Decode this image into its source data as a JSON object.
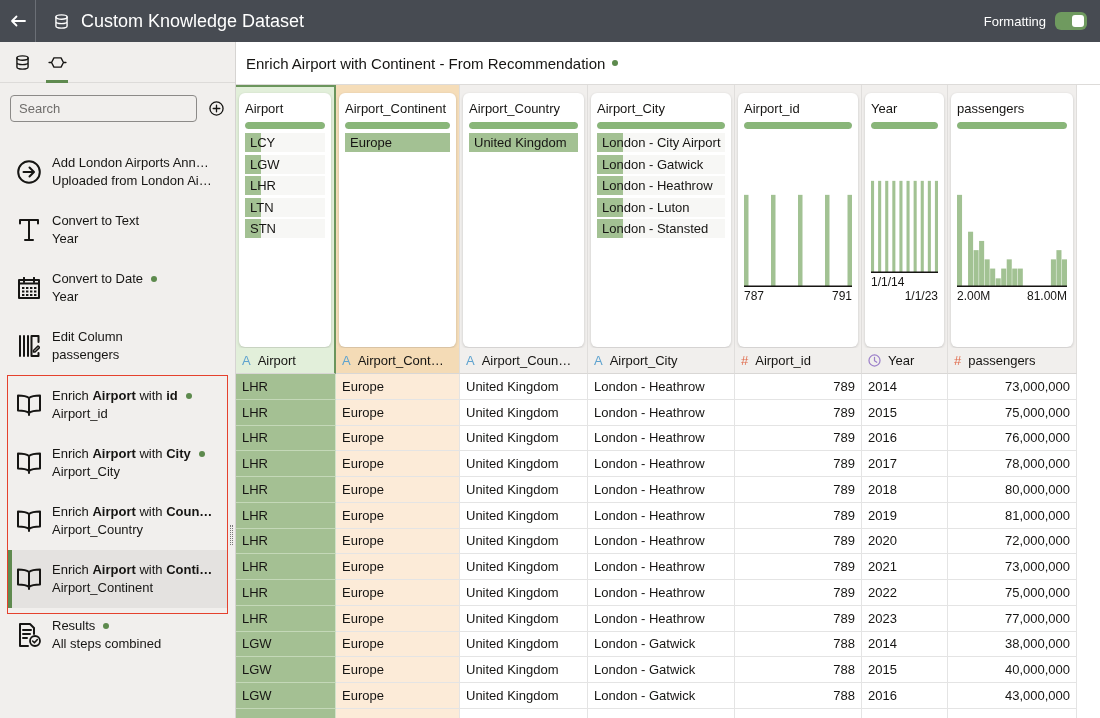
{
  "top_bar": {
    "title": "Custom Knowledge Dataset",
    "formatting": {
      "label": "Formatting",
      "on": true
    }
  },
  "sidebar": {
    "tabs": [
      {
        "kind": "dataset",
        "selected": false
      },
      {
        "kind": "steps",
        "selected": true
      }
    ],
    "search": {
      "placeholder": "Search"
    },
    "steps": [
      {
        "kind": "source",
        "title": "Add London Airports Ann…",
        "subtitle": "Uploaded from London Ai…",
        "dot": false,
        "selected": false,
        "highlighted": false
      },
      {
        "kind": "text",
        "title": "Convert to Text",
        "subtitle": "Year",
        "dot": false,
        "selected": false,
        "highlighted": false
      },
      {
        "kind": "date",
        "title": "Convert to Date",
        "subtitle": "Year",
        "dot": true,
        "selected": false,
        "highlighted": false
      },
      {
        "kind": "edit",
        "title": "Edit Column",
        "subtitle": "passengers",
        "dot": false,
        "selected": false,
        "highlighted": false
      },
      {
        "kind": "enrich",
        "title": "Enrich **Airport** with **id**",
        "subtitle": "Airport_id",
        "dot": true,
        "selected": false,
        "highlighted": true
      },
      {
        "kind": "enrich",
        "title": "Enrich **Airport** with **City**",
        "subtitle": "Airport_City",
        "dot": true,
        "selected": false,
        "highlighted": true
      },
      {
        "kind": "enrich",
        "title": "Enrich **Airport** with **Coun…**",
        "subtitle": "Airport_Country",
        "dot": false,
        "selected": false,
        "highlighted": true
      },
      {
        "kind": "enrich",
        "title": "Enrich **Airport** with **Conti…**",
        "subtitle": "Airport_Continent",
        "dot": false,
        "selected": true,
        "highlighted": true
      },
      {
        "kind": "results",
        "title": "Results",
        "subtitle": "All steps combined",
        "dot": true,
        "selected": false,
        "highlighted": false
      }
    ]
  },
  "header": {
    "title": "Enrich Airport with Continent - From Recommendation",
    "dot": true
  },
  "columns": [
    {
      "name": "Airport",
      "label": "Airport",
      "kind": "text",
      "type_symbol": "A",
      "selected": true,
      "added": false,
      "quality": {
        "level": 1
      },
      "profile": {
        "kind": "values",
        "values": [
          {
            "label": "LCY",
            "level": 0.2
          },
          {
            "label": "LGW",
            "level": 0.2
          },
          {
            "label": "LHR",
            "level": 0.2
          },
          {
            "label": "LTN",
            "level": 0.2
          },
          {
            "label": "STN",
            "level": 0.2
          }
        ]
      }
    },
    {
      "name": "Airport_Continent",
      "label": "Airport_Cont…",
      "kind": "text",
      "type_symbol": "A",
      "selected": false,
      "added": true,
      "quality": {
        "level": 1
      },
      "profile": {
        "kind": "values",
        "values": [
          {
            "label": "Europe",
            "level": 1
          }
        ]
      }
    },
    {
      "name": "Airport_Country",
      "label": "Airport_Coun…",
      "kind": "text",
      "type_symbol": "A",
      "selected": false,
      "added": false,
      "quality": {
        "level": 1
      },
      "profile": {
        "kind": "values",
        "values": [
          {
            "label": "United Kingdom",
            "level": 1
          }
        ]
      }
    },
    {
      "name": "Airport_City",
      "label": "Airport_City",
      "kind": "text",
      "type_symbol": "A",
      "selected": false,
      "added": false,
      "quality": {
        "level": 1
      },
      "profile": {
        "kind": "values",
        "values": [
          {
            "label": "London - City Airport",
            "level": 0.2
          },
          {
            "label": "London - Gatwick",
            "level": 0.2
          },
          {
            "label": "London - Heathrow",
            "level": 0.2
          },
          {
            "label": "London - Luton",
            "level": 0.2
          },
          {
            "label": "London - Stansted",
            "level": 0.2
          }
        ]
      }
    },
    {
      "name": "Airport_id",
      "label": "Airport_id",
      "kind": "number",
      "type_symbol": "#",
      "selected": false,
      "added": false,
      "quality": {
        "level": 1
      },
      "profile": {
        "kind": "histogram",
        "bars": {
          "kind": "spikes"
        },
        "min_label": "787",
        "max_label": "791"
      }
    },
    {
      "name": "Year",
      "label": "Year",
      "kind": "date",
      "selected": false,
      "added": false,
      "quality": {
        "level": 1
      },
      "profile": {
        "kind": "histogram",
        "bars": {
          "kind": "uniform"
        },
        "min_label": "1/1/14",
        "max_label": "1/1/23"
      }
    },
    {
      "name": "passengers",
      "label": "passengers",
      "kind": "number",
      "type_symbol": "#",
      "selected": false,
      "added": false,
      "quality": {
        "level": 1
      },
      "profile": {
        "kind": "histogram",
        "bars": {
          "kind": "skewed"
        },
        "min_label": "2.00M",
        "max_label": "81.00M"
      }
    }
  ],
  "rows": [
    [
      "LHR",
      "Europe",
      "United Kingdom",
      "London - Heathrow",
      "789",
      "2014",
      "73,000,000"
    ],
    [
      "LHR",
      "Europe",
      "United Kingdom",
      "London - Heathrow",
      "789",
      "2015",
      "75,000,000"
    ],
    [
      "LHR",
      "Europe",
      "United Kingdom",
      "London - Heathrow",
      "789",
      "2016",
      "76,000,000"
    ],
    [
      "LHR",
      "Europe",
      "United Kingdom",
      "London - Heathrow",
      "789",
      "2017",
      "78,000,000"
    ],
    [
      "LHR",
      "Europe",
      "United Kingdom",
      "London - Heathrow",
      "789",
      "2018",
      "80,000,000"
    ],
    [
      "LHR",
      "Europe",
      "United Kingdom",
      "London - Heathrow",
      "789",
      "2019",
      "81,000,000"
    ],
    [
      "LHR",
      "Europe",
      "United Kingdom",
      "London - Heathrow",
      "789",
      "2020",
      "72,000,000"
    ],
    [
      "LHR",
      "Europe",
      "United Kingdom",
      "London - Heathrow",
      "789",
      "2021",
      "73,000,000"
    ],
    [
      "LHR",
      "Europe",
      "United Kingdom",
      "London - Heathrow",
      "789",
      "2022",
      "75,000,000"
    ],
    [
      "LHR",
      "Europe",
      "United Kingdom",
      "London - Heathrow",
      "789",
      "2023",
      "77,000,000"
    ],
    [
      "LGW",
      "Europe",
      "United Kingdom",
      "London - Gatwick",
      "788",
      "2014",
      "38,000,000"
    ],
    [
      "LGW",
      "Europe",
      "United Kingdom",
      "London - Gatwick",
      "788",
      "2015",
      "40,000,000"
    ],
    [
      "LGW",
      "Europe",
      "United Kingdom",
      "London - Gatwick",
      "788",
      "2016",
      "43,000,000"
    ]
  ]
}
